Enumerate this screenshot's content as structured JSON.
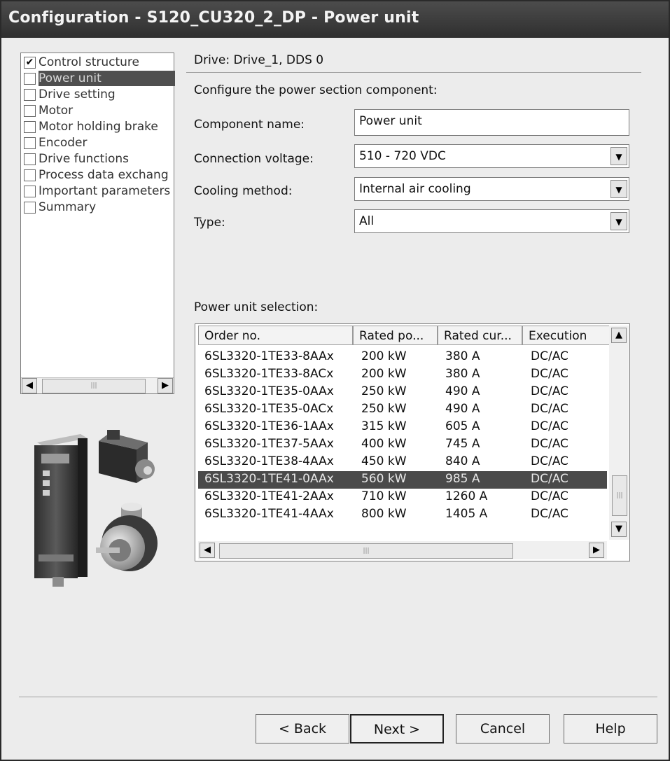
{
  "window": {
    "title": "Configuration - S120_CU320_2_DP - Power unit"
  },
  "tree": {
    "items": [
      {
        "label": "Control structure",
        "checked": "✔"
      },
      {
        "label": "Power unit",
        "checked": ""
      },
      {
        "label": "Drive setting",
        "checked": ""
      },
      {
        "label": "Motor",
        "checked": ""
      },
      {
        "label": "Motor holding brake",
        "checked": ""
      },
      {
        "label": "Encoder",
        "checked": ""
      },
      {
        "label": "Drive functions",
        "checked": ""
      },
      {
        "label": "Process data exchang",
        "checked": ""
      },
      {
        "label": "Important parameters",
        "checked": ""
      },
      {
        "label": "Summary",
        "checked": ""
      }
    ],
    "selected_index": 1
  },
  "header": {
    "drive": "Drive: Drive_1, DDS 0",
    "instruction": "Configure the power section component:"
  },
  "form": {
    "component_name_label": "Component name:",
    "component_name_value": "Power unit",
    "connection_voltage_label": "Connection voltage:",
    "connection_voltage_value": "510 - 720 VDC",
    "cooling_method_label": "Cooling method:",
    "cooling_method_value": "Internal air cooling",
    "type_label": "Type:",
    "type_value": "All"
  },
  "selection": {
    "label": "Power unit selection:",
    "columns": [
      "Order no.",
      "Rated po...",
      "Rated cur...",
      "Execution"
    ],
    "rows": [
      [
        "6SL3320-1TE33-8AAx",
        "200 kW",
        "380 A",
        "DC/AC"
      ],
      [
        "6SL3320-1TE33-8ACx",
        "200 kW",
        "380 A",
        "DC/AC"
      ],
      [
        "6SL3320-1TE35-0AAx",
        "250 kW",
        "490 A",
        "DC/AC"
      ],
      [
        "6SL3320-1TE35-0ACx",
        "250 kW",
        "490 A",
        "DC/AC"
      ],
      [
        "6SL3320-1TE36-1AAx",
        "315 kW",
        "605 A",
        "DC/AC"
      ],
      [
        "6SL3320-1TE37-5AAx",
        "400 kW",
        "745 A",
        "DC/AC"
      ],
      [
        "6SL3320-1TE38-4AAx",
        "450 kW",
        "840 A",
        "DC/AC"
      ],
      [
        "6SL3320-1TE41-0AAx",
        "560 kW",
        "985 A",
        "DC/AC"
      ],
      [
        "6SL3320-1TE41-2AAx",
        "710 kW",
        "1260 A",
        "DC/AC"
      ],
      [
        "6SL3320-1TE41-4AAx",
        "800 kW",
        "1405 A",
        "DC/AC"
      ]
    ],
    "selected_row": 7
  },
  "icons": {
    "checkbox_checked": "check-icon",
    "dropdown": "chevron-down-icon",
    "scroll_left": "◀",
    "scroll_right": "▶",
    "scroll_up": "▲",
    "scroll_down": "▼",
    "grip": "|||"
  },
  "buttons": {
    "back": "< Back",
    "next": "Next >",
    "cancel": "Cancel",
    "help": "Help"
  }
}
